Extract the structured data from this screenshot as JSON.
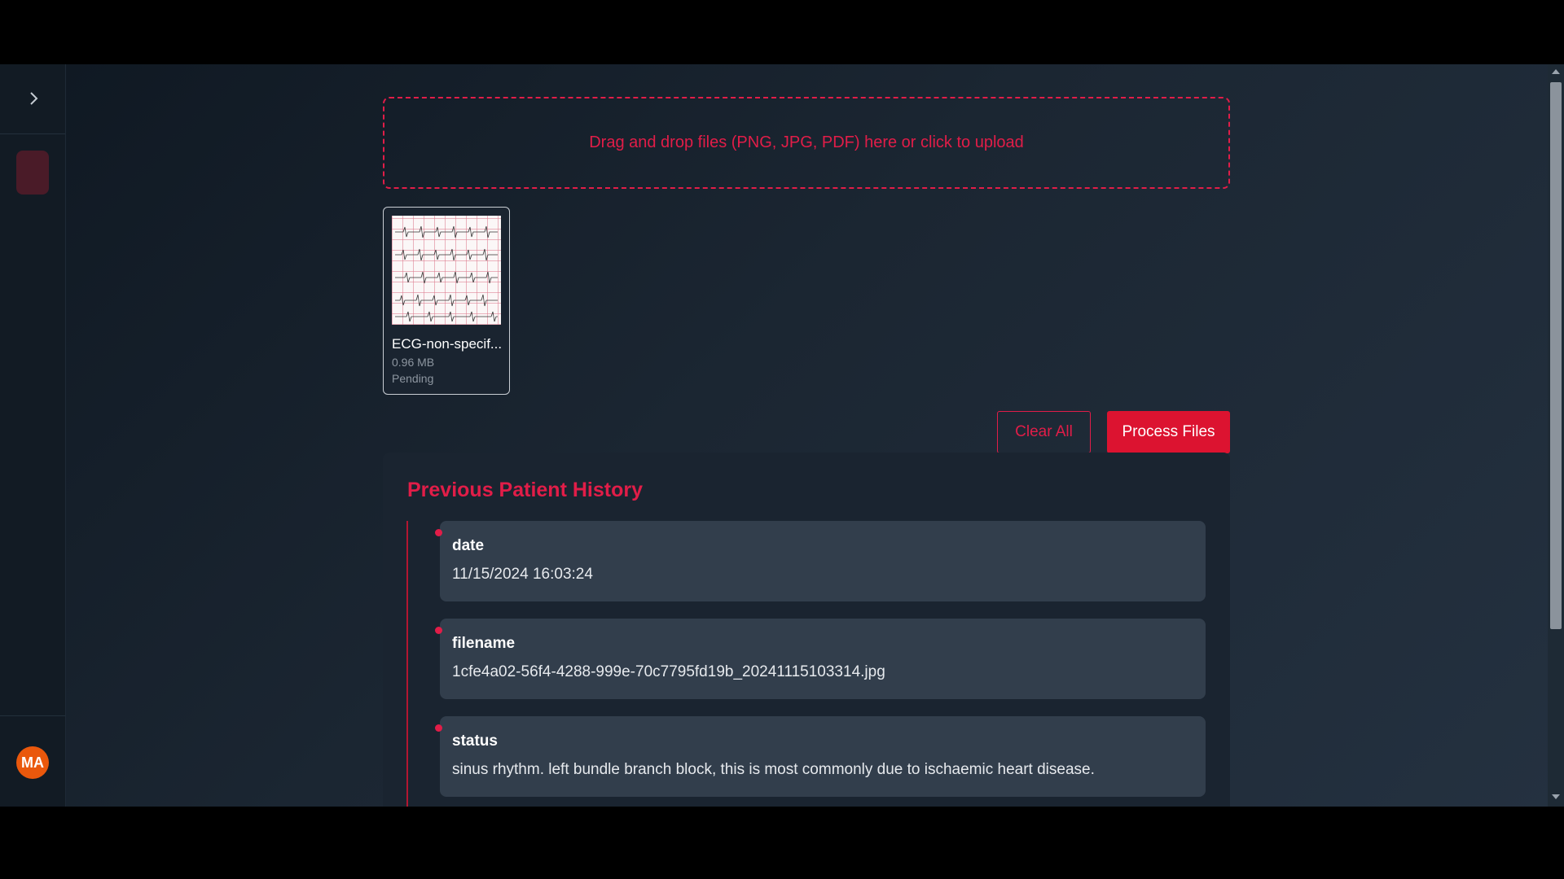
{
  "sidebar": {
    "expand_icon": "chevron-right-icon",
    "avatar_initials": "MA",
    "avatar_color": "#ea580c",
    "active_item_color": "#4a1b28"
  },
  "upload": {
    "dropzone_text": "Drag and drop files (PNG, JPG, PDF) here or click to upload"
  },
  "files": [
    {
      "name": "ECG-non-specif...",
      "size": "0.96 MB",
      "status": "Pending"
    }
  ],
  "actions": {
    "clear_label": "Clear All",
    "process_label": "Process Files"
  },
  "history": {
    "title": "Previous Patient History",
    "entries": [
      {
        "label": "date",
        "value": "11/15/2024 16:03:24"
      },
      {
        "label": "filename",
        "value": "1cfe4a02-56f4-4288-999e-70c7795fd19b_20241115103314.jpg"
      },
      {
        "label": "status",
        "value": "sinus rhythm. left bundle branch block, this is most commonly due to ischaemic heart disease."
      }
    ]
  },
  "colors": {
    "accent": "#e11d48",
    "primary_button": "#dc1330",
    "background": "#1b2632",
    "card": "#323e4c"
  }
}
